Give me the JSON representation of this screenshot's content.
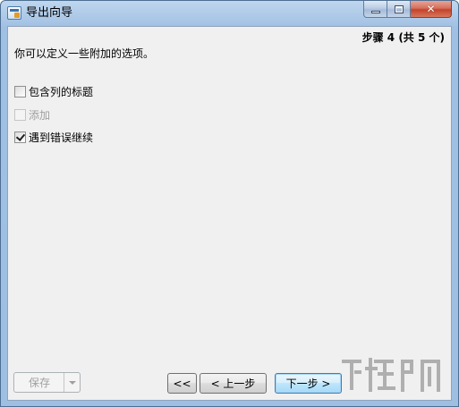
{
  "window": {
    "title": "导出向导",
    "close_glyph": "✕"
  },
  "header": {
    "step": "步骤 4 (共 5 个)"
  },
  "main": {
    "description": "你可以定义一些附加的选项。",
    "options": [
      {
        "label": "包含列的标题",
        "checked": false,
        "enabled": true
      },
      {
        "label": "添加",
        "checked": false,
        "enabled": false
      },
      {
        "label": "遇到错误继续",
        "checked": true,
        "enabled": true
      }
    ]
  },
  "footer": {
    "save_label": "保存",
    "first_label": "<<",
    "prev_label": "< 上一步",
    "next_label": "下一步 >"
  },
  "icons": {
    "app": "app-icon",
    "minimize": "minimize-icon",
    "maximize": "maximize-icon",
    "close": "close-icon",
    "dropdown": "chevron-down-icon",
    "check": "checkmark-icon"
  },
  "colors": {
    "title_bar": "#a9c6e6",
    "client_bg": "#f0f0f0",
    "close_button": "#c4432b",
    "default_button_border": "#3c7fb1"
  }
}
